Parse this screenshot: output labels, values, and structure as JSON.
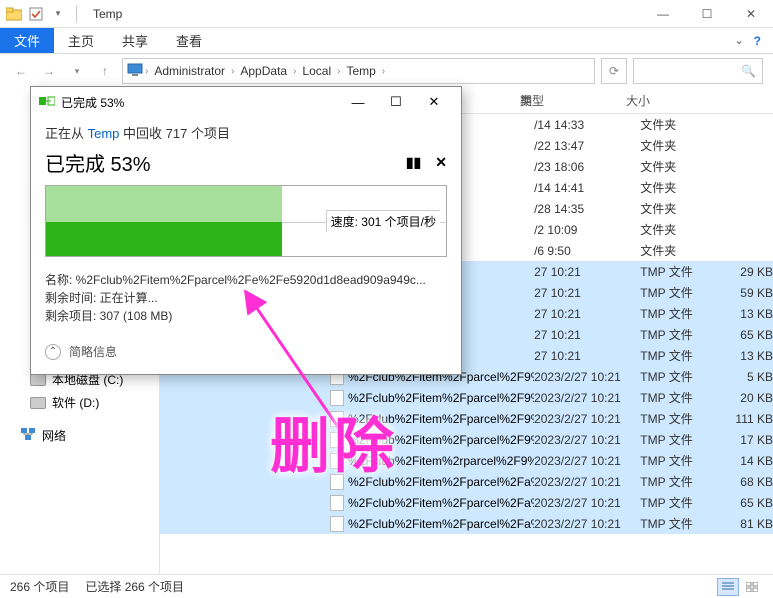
{
  "window": {
    "title": "Temp",
    "tabs": {
      "file": "文件",
      "home": "主页",
      "share": "共享",
      "view": "查看"
    }
  },
  "breadcrumb": [
    "Administrator",
    "AppData",
    "Local",
    "Temp"
  ],
  "columns": {
    "date": "期",
    "type": "类型",
    "size": "大小"
  },
  "sidebar": {
    "drive_c": "本地磁盘 (C:)",
    "drive_d": "软件 (D:)",
    "network": "网络"
  },
  "rows": [
    {
      "name": "",
      "date": "/14 14:33",
      "type": "文件夹",
      "size": ""
    },
    {
      "name": "",
      "date": "/22 13:47",
      "type": "文件夹",
      "size": ""
    },
    {
      "name": "",
      "date": "/23 18:06",
      "type": "文件夹",
      "size": ""
    },
    {
      "name": "",
      "date": "/14 14:41",
      "type": "文件夹",
      "size": ""
    },
    {
      "name": "",
      "date": "/28 14:35",
      "type": "文件夹",
      "size": ""
    },
    {
      "name": "",
      "date": "/2 10:09",
      "type": "文件夹",
      "size": ""
    },
    {
      "name": "",
      "date": "/6 9:50",
      "type": "文件夹",
      "size": ""
    },
    {
      "name": "",
      "date": "27 10:21",
      "type": "TMP 文件",
      "size": "29 KB",
      "sel": true
    },
    {
      "name": "",
      "date": "27 10:21",
      "type": "TMP 文件",
      "size": "59 KB",
      "sel": true
    },
    {
      "name": "",
      "date": "27 10:21",
      "type": "TMP 文件",
      "size": "13 KB",
      "sel": true
    },
    {
      "name": "",
      "date": "27 10:21",
      "type": "TMP 文件",
      "size": "65 KB",
      "sel": true
    },
    {
      "name": "",
      "date": "27 10:21",
      "type": "TMP 文件",
      "size": "13 KB",
      "sel": true
    },
    {
      "name": "%2Fclub%2Fitem%2Fparcel%2F9%2F...",
      "date": "2023/2/27 10:21",
      "type": "TMP 文件",
      "size": "5 KB",
      "sel": true,
      "showname": true
    },
    {
      "name": "%2Fclub%2Fitem%2Fparcel%2F9%2F...",
      "date": "2023/2/27 10:21",
      "type": "TMP 文件",
      "size": "20 KB",
      "sel": true,
      "showname": true
    },
    {
      "name": "%2Fclub%2Fitem%2Fparcel%2F9%2F...",
      "date": "2023/2/27 10:21",
      "type": "TMP 文件",
      "size": "111 KB",
      "sel": true,
      "showname": true
    },
    {
      "name": "%2Fclub%2Fitem%2Fparcel%2F9%2F...",
      "date": "2023/2/27 10:21",
      "type": "TMP 文件",
      "size": "17 KB",
      "sel": true,
      "showname": true
    },
    {
      "name": "%2Fclub%2Fitem%2rparcel%2F9%2F...",
      "date": "2023/2/27 10:21",
      "type": "TMP 文件",
      "size": "14 KB",
      "sel": true,
      "showname": true
    },
    {
      "name": "%2Fclub%2Fitem%2Fparcel%2Fa%2F...",
      "date": "2023/2/27 10:21",
      "type": "TMP 文件",
      "size": "68 KB",
      "sel": true,
      "showname": true
    },
    {
      "name": "%2Fclub%2Fitem%2Fparcel%2Fa%2F...",
      "date": "2023/2/27 10:21",
      "type": "TMP 文件",
      "size": "65 KB",
      "sel": true,
      "showname": true
    },
    {
      "name": "%2Fclub%2Fitem%2Fparcel%2Fa%2F...",
      "date": "2023/2/27 10:21",
      "type": "TMP 文件",
      "size": "81 KB",
      "sel": true,
      "showname": true
    }
  ],
  "status": {
    "items": "266 个项目",
    "selected": "已选择 266 个项目"
  },
  "dialog": {
    "title_prefix": "已完成 53%",
    "action_prefix": "正在从 ",
    "action_link": "Temp",
    "action_suffix": " 中回收 717 个项目",
    "progress": "已完成 53%",
    "speed": "速度: 301 个项目/秒",
    "name_label": "名称: ",
    "name_value": "%2Fclub%2Fitem%2Fparcel%2Fe%2Fe5920d1d8ead909a949c...",
    "time_label": "剩余时间: ",
    "time_value": "正在计算...",
    "remain_label": "剩余项目: ",
    "remain_value": "307 (108 MB)",
    "more": "简略信息"
  },
  "annotation": "删除",
  "search_icon": "🔍",
  "icons": {
    "folder_small": "📁",
    "pc": "🖥",
    "net": "🖧"
  }
}
